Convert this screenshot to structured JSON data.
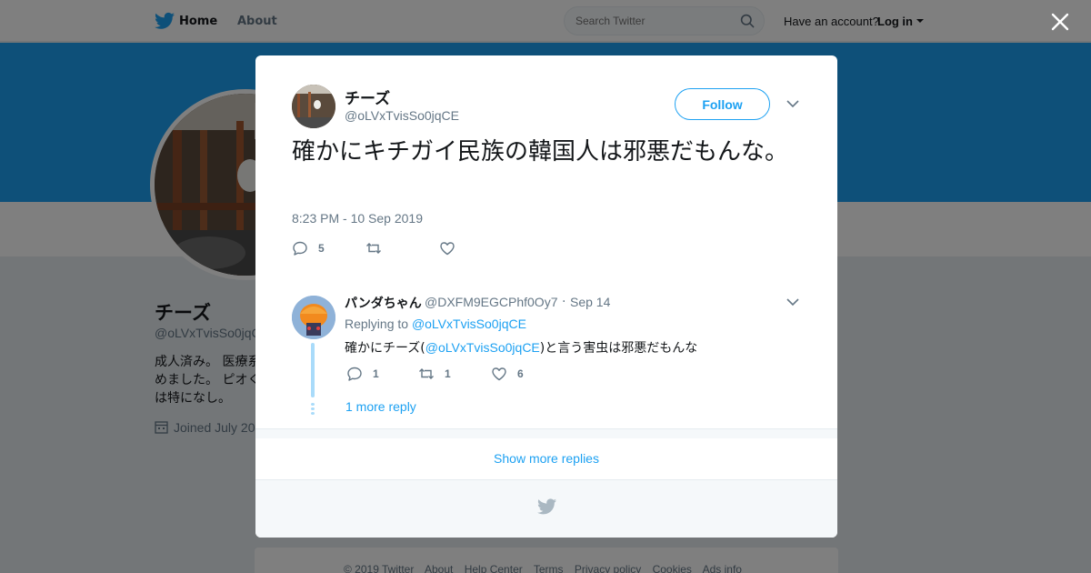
{
  "topbar": {
    "home": "Home",
    "about": "About",
    "search_placeholder": "Search Twitter",
    "have_account": "Have an account?",
    "login": "Log in"
  },
  "profile": {
    "name": "チーズ",
    "handle": "@oLVxTvisSo0jqC",
    "bio": "成人済み。 医療系 めました。 ピオく は特になし。",
    "joined": "Joined July 20"
  },
  "tweet": {
    "name": "チーズ",
    "handle": "@oLVxTvisSo0jqCE",
    "follow_label": "Follow",
    "text": "確かにキチガイ民族の韓国人は邪悪だもんな。",
    "timestamp": "8:23 PM - 10 Sep 2019",
    "reply_count": "5",
    "retweet_count": "",
    "like_count": ""
  },
  "reply": {
    "name": "パンダちゃん",
    "handle": "@DXFM9EGCPhf0Oy7",
    "separator": "·",
    "date": "Sep 14",
    "replying_prefix": "Replying to",
    "replying_to": "@oLVxTvisSo0jqCE",
    "text_before": "確かにチーズ(",
    "text_mention": "@oLVxTvisSo0jqCE",
    "text_after": ")と言う害虫は邪悪だもんな",
    "reply_count": "1",
    "retweet_count": "1",
    "like_count": "6",
    "more_reply": "1 more reply"
  },
  "show_more_replies": "Show more replies",
  "footer": {
    "links": [
      "© 2019 Twitter",
      "About",
      "Help Center",
      "Terms",
      "Privacy policy",
      "Cookies",
      "Ads info"
    ]
  },
  "colors": {
    "accent": "#1da1f2",
    "banner": "#1da1f2",
    "text": "#14171a",
    "muted": "#657786"
  },
  "icons": {
    "logo": "twitter-bird-icon",
    "search": "search-icon",
    "close": "close-icon",
    "chevron": "chevron-down-icon",
    "reply": "reply-icon",
    "retweet": "retweet-icon",
    "like": "heart-icon",
    "calendar": "calendar-icon"
  }
}
